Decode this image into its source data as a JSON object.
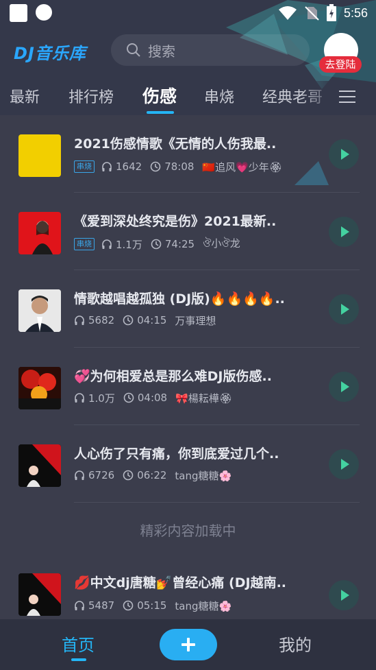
{
  "status_bar": {
    "time": "5:56"
  },
  "header": {
    "logo": "DJ音乐库",
    "search_placeholder": "搜索",
    "login_label": "去登陆"
  },
  "tabs": [
    "最新",
    "排行榜",
    "伤感",
    "串烧",
    "经典老哥"
  ],
  "active_tab": "伤感",
  "songs": [
    {
      "title": "2021伤感情歌《无情的人伤我最..",
      "tag": "串烧",
      "plays": "1642",
      "duration": "78:08",
      "author": "🇨🇳追风💗少年🏵"
    },
    {
      "title": "《爱到深处终究是伤》2021最新..",
      "tag": "串烧",
      "plays": "1.1万",
      "duration": "74:25",
      "author": "ঔ小ঔ龙"
    },
    {
      "title": "情歌越唱越孤独 (DJ版)🔥🔥🔥🔥..",
      "plays": "5682",
      "duration": "04:15",
      "author": "万事理想"
    },
    {
      "title": "💞为何相爱总是那么难DJ版伤感..",
      "plays": "1.0万",
      "duration": "04:08",
      "author": "🎀楊耘樺🏵"
    },
    {
      "title": "人心伤了只有痛，你到底爱过几个..",
      "plays": "6726",
      "duration": "06:22",
      "author": "tang糖糖🌸"
    },
    {
      "title": "💋中文dj唐糖💅曾经心痛 (DJ越南..",
      "plays": "5487",
      "duration": "05:15",
      "author": "tang糖糖🌸"
    }
  ],
  "loading_text": "精彩内容加载中",
  "bottom_nav": {
    "home": "首页",
    "mine": "我的"
  },
  "colors": {
    "accent": "#24b5f5",
    "bg": "#3b3d4c",
    "badge": "#e52d3c"
  }
}
